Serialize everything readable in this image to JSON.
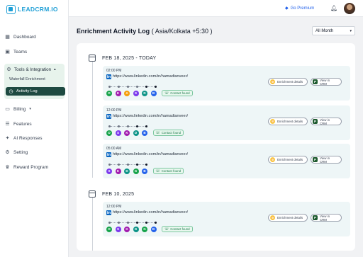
{
  "app": {
    "logo_text": "LEADCRM.IO"
  },
  "topbar": {
    "premium_label": "Go Premium"
  },
  "sidebar": {
    "items": [
      {
        "label": "Dashboard",
        "icon": "grid-icon"
      },
      {
        "label": "Teams",
        "icon": "teams-icon"
      }
    ],
    "group": {
      "label": "Tools & Integration",
      "sub_items": [
        {
          "label": "Waterfall Enrichment"
        }
      ],
      "active_item": {
        "label": "Activity Log"
      }
    },
    "lower_items": [
      {
        "label": "Billing"
      },
      {
        "label": "Features"
      },
      {
        "label": "AI Responses"
      },
      {
        "label": "Setting"
      },
      {
        "label": "Reward Program"
      }
    ]
  },
  "main": {
    "title": "Enrichment Activity Log",
    "timezone": "( Asia/Kolkata +5:30 )",
    "range": "All Month"
  },
  "groups": [
    {
      "date": "FEB 18, 2025 - TODAY",
      "entries": [
        {
          "time": "02:00 PM",
          "url": "https://www.linkedin.com/in/hamadtanveer/",
          "providers": [
            "O",
            "K",
            "A",
            "S",
            "D",
            "B"
          ],
          "status": "Contact found"
        },
        {
          "time": "12:00 PM",
          "url": "https://www.linkedin.com/in/hamadtanveer/",
          "providers": [
            "O",
            "S",
            "K",
            "D",
            "B"
          ],
          "status": "Contact found"
        },
        {
          "time": "05:00 AM",
          "url": "https://www.linkedin.com/in/hamadtanveer/",
          "providers": [
            "S",
            "K",
            "D",
            "G",
            "B"
          ],
          "status": "Contact found"
        }
      ]
    },
    {
      "date": "FEB 10, 2025",
      "entries": [
        {
          "time": "12:00 PM",
          "url": "https://www.linkedin.com/in/hamadtanveer/",
          "providers": [
            "O",
            "S",
            "K",
            "D",
            "G",
            "B"
          ],
          "status": "Contact found"
        }
      ]
    }
  ],
  "actions": {
    "enrich": "Enrichment details",
    "crm": "View in CRM"
  },
  "colors": {
    "accent": "#1e4a41",
    "entry_bg": "#eef6f7",
    "linkedin": "#0a66c2",
    "badge": "#1f7a4d"
  }
}
